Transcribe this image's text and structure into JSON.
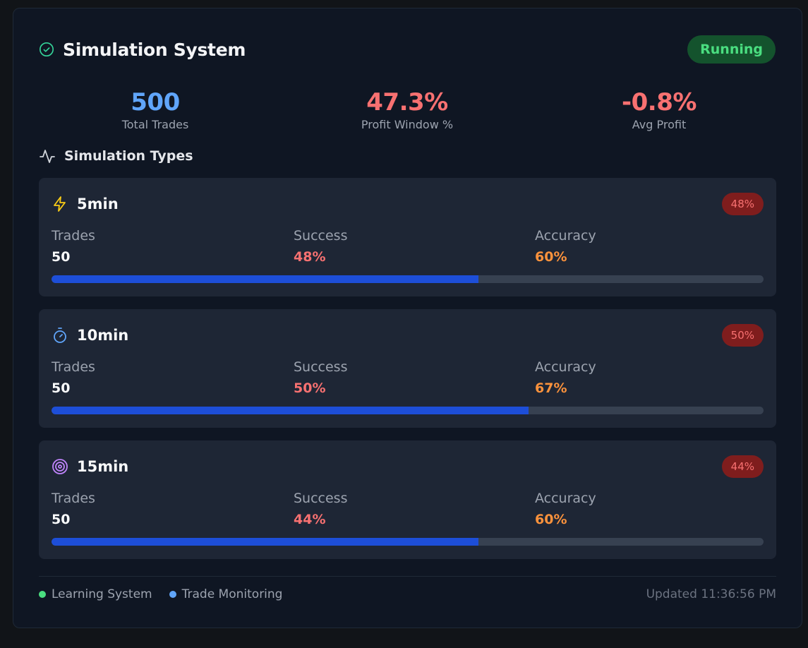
{
  "header": {
    "title": "Simulation System",
    "status": "Running",
    "status_color": "#4ade80"
  },
  "stats": [
    {
      "value": "500",
      "label": "Total Trades",
      "color": "#60a5fa"
    },
    {
      "value": "47.3%",
      "label": "Profit Window %",
      "color": "#f87171"
    },
    {
      "value": "-0.8%",
      "label": "Avg Profit",
      "color": "#f87171"
    }
  ],
  "section": {
    "title": "Simulation Types"
  },
  "labels": {
    "trades": "Trades",
    "success": "Success",
    "accuracy": "Accuracy"
  },
  "types": [
    {
      "name": "5min",
      "icon": "lightning-icon",
      "badge": "48%",
      "trades": "50",
      "success": "48%",
      "accuracy": "60%",
      "progress": 0.6
    },
    {
      "name": "10min",
      "icon": "timer-icon",
      "badge": "50%",
      "trades": "50",
      "success": "50%",
      "accuracy": "67%",
      "progress": 0.67
    },
    {
      "name": "15min",
      "icon": "target-icon",
      "badge": "44%",
      "trades": "50",
      "success": "44%",
      "accuracy": "60%",
      "progress": 0.6
    }
  ],
  "colors": {
    "success": "#f87171",
    "accuracy": "#fb923c",
    "progress": "#1d4ed8"
  },
  "footer": {
    "legend": [
      {
        "label": "Learning System",
        "color": "#4ade80"
      },
      {
        "label": "Trade Monitoring",
        "color": "#60a5fa"
      }
    ],
    "updated": "Updated 11:36:56 PM"
  }
}
